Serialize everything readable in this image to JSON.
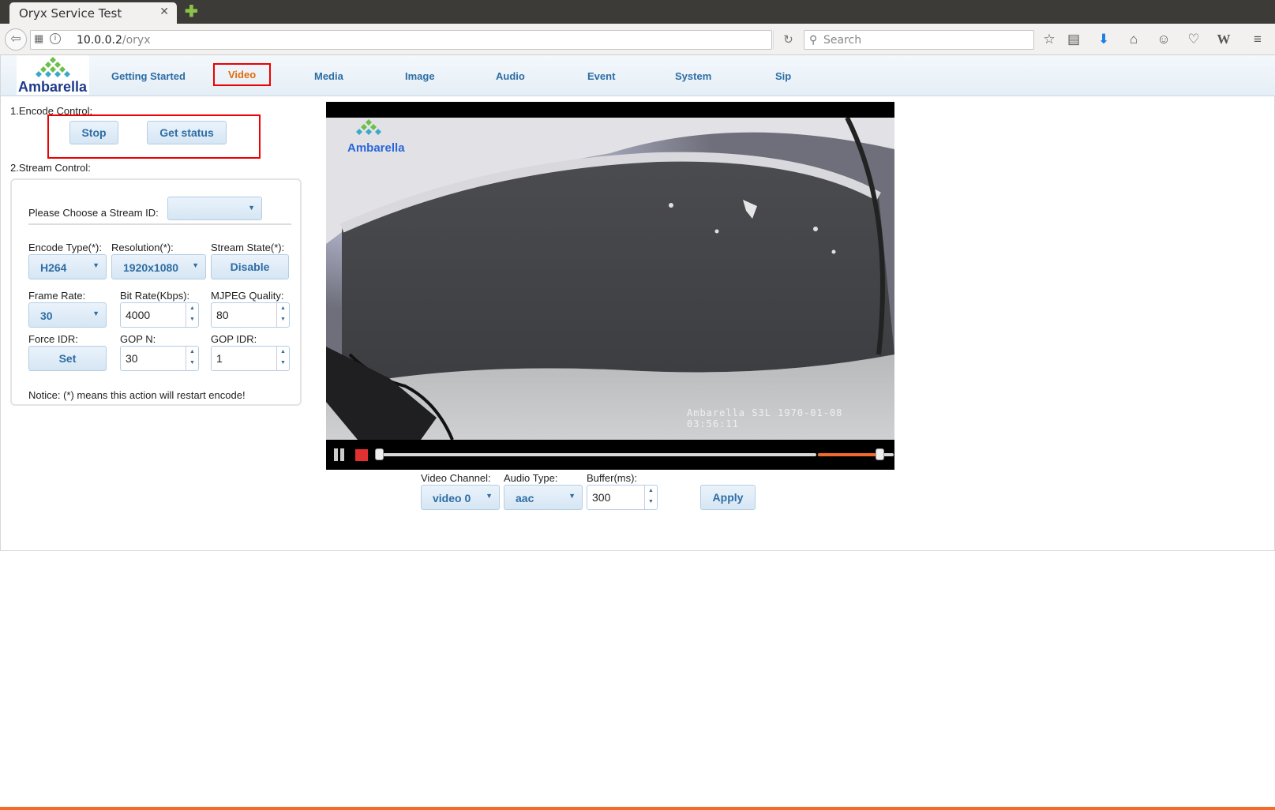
{
  "browser": {
    "tab_title": "Oryx Service Test",
    "url_host": "10.0.0.2",
    "url_path": "/oryx",
    "search_placeholder": "Search"
  },
  "logo_text": "Ambarella",
  "menu": [
    "Getting Started",
    "Video",
    "Media",
    "Image",
    "Audio",
    "Event",
    "System",
    "Sip"
  ],
  "menu_active": "Video",
  "encode": {
    "label": "1.Encode Control:",
    "stop": "Stop",
    "get_status": "Get status"
  },
  "stream": {
    "label": "2.Stream Control:",
    "choose_label": "Please Choose a Stream ID:",
    "stream_id": "",
    "encode_type_label": "Encode Type(*):",
    "encode_type": "H264",
    "resolution_label": "Resolution(*):",
    "resolution": "1920x1080",
    "stream_state_label": "Stream State(*):",
    "stream_state_button": "Disable",
    "frame_rate_label": "Frame Rate:",
    "frame_rate": "30",
    "bit_rate_label": "Bit Rate(Kbps):",
    "bit_rate": "4000",
    "mjpeg_quality_label": "MJPEG Quality:",
    "mjpeg_quality": "80",
    "force_idr_label": "Force IDR:",
    "force_idr_button": "Set",
    "gop_n_label": "GOP N:",
    "gop_n": "30",
    "gop_idr_label": "GOP IDR:",
    "gop_idr": "1",
    "notice": "Notice: (*) means this action will restart encode!"
  },
  "player": {
    "overlay_logo": "Ambarella",
    "timestamp": "Ambarella S3L 1970-01-08 03:56:11",
    "seek_progress": 0.0,
    "volume_level": 0.81
  },
  "playback": {
    "video_channel_label": "Video Channel:",
    "video_channel": "video 0",
    "audio_type_label": "Audio Type:",
    "audio_type": "aac",
    "buffer_label": "Buffer(ms):",
    "buffer": "300",
    "apply": "Apply"
  },
  "colors": {
    "accent": "#2e6da4",
    "active_menu": "#e36c0a",
    "highlight_box": "#ee0000",
    "volume": "#f26b2c"
  }
}
